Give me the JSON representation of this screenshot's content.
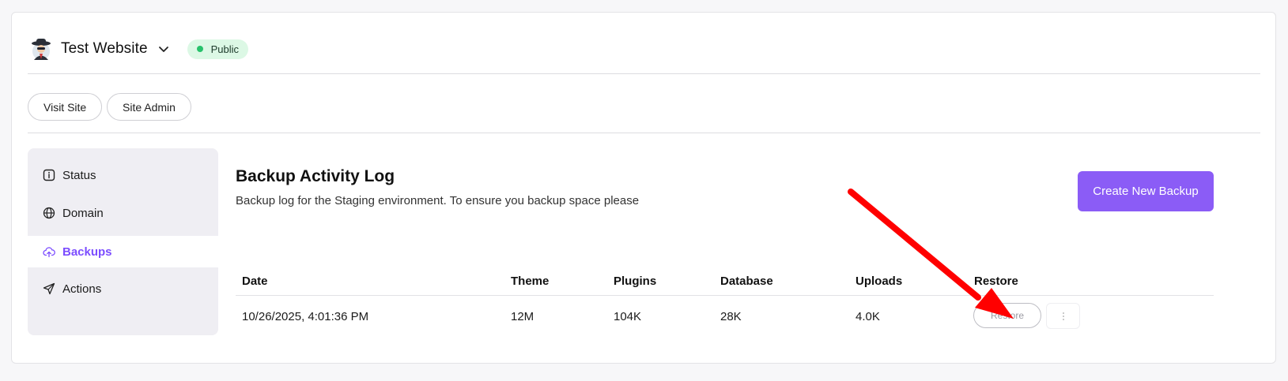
{
  "site": {
    "title": "Test Website",
    "status_badge": "Public",
    "status_color": "#27c26b"
  },
  "links": {
    "visit_site": "Visit Site",
    "site_admin": "Site Admin"
  },
  "sidebar": {
    "items": [
      {
        "label": "Status",
        "icon": "info-icon",
        "active": false
      },
      {
        "label": "Domain",
        "icon": "globe-icon",
        "active": false
      },
      {
        "label": "Backups",
        "icon": "cloud-upload-icon",
        "active": true
      },
      {
        "label": "Actions",
        "icon": "send-icon",
        "active": false
      }
    ]
  },
  "main": {
    "title": "Backup Activity Log",
    "description": "Backup log for the Staging environment. To ensure you backup space please",
    "create_button": "Create New Backup",
    "accent_color": "#8b5cf6"
  },
  "table": {
    "headers": [
      "Date",
      "Theme",
      "Plugins",
      "Database",
      "Uploads",
      "Restore"
    ],
    "rows": [
      {
        "date": "10/26/2025, 4:01:36 PM",
        "theme": "12M",
        "plugins": "104K",
        "database": "28K",
        "uploads": "4.0K",
        "restore_label": "Restore"
      }
    ]
  },
  "annotation": {
    "icon": "red-arrow-icon",
    "color": "#ff0000"
  }
}
